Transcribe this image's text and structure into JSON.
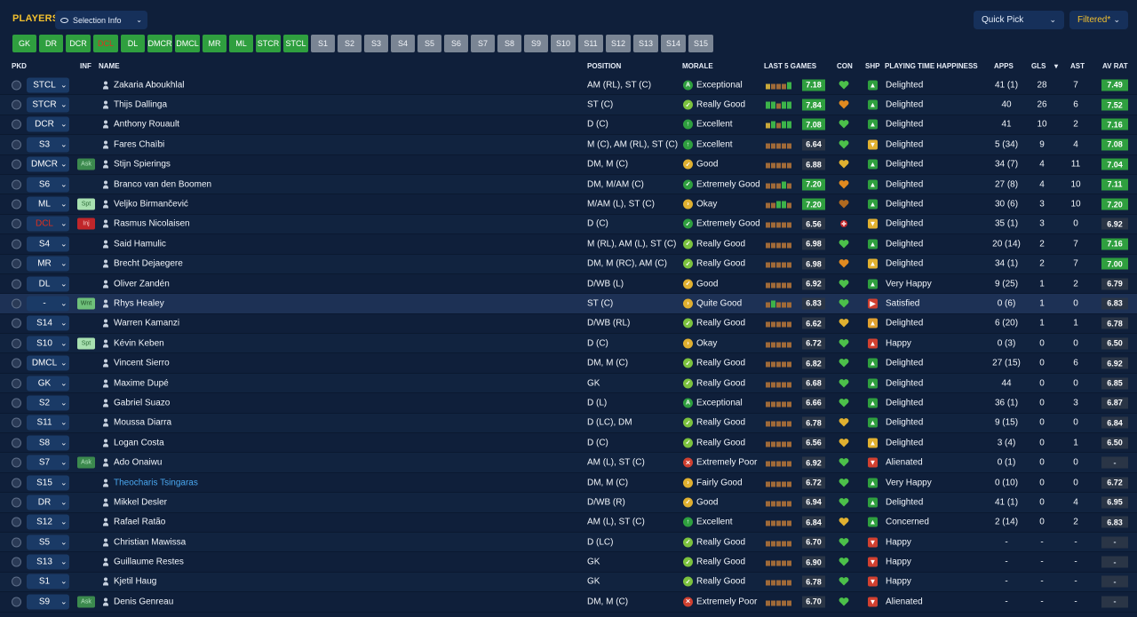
{
  "header": {
    "title": "PLAYERS",
    "selection_info": "Selection Info",
    "quick_pick": "Quick Pick",
    "filtered": "Filtered*"
  },
  "positions": [
    {
      "label": "GK",
      "state": "on"
    },
    {
      "label": "DR",
      "state": "on"
    },
    {
      "label": "DCR",
      "state": "on"
    },
    {
      "label": "DCL",
      "state": "onred"
    },
    {
      "label": "DL",
      "state": "on"
    },
    {
      "label": "DMCR",
      "state": "on"
    },
    {
      "label": "DMCL",
      "state": "on"
    },
    {
      "label": "MR",
      "state": "on"
    },
    {
      "label": "ML",
      "state": "on"
    },
    {
      "label": "STCR",
      "state": "on"
    },
    {
      "label": "STCL",
      "state": "on"
    },
    {
      "label": "S1",
      "state": "off"
    },
    {
      "label": "S2",
      "state": "off"
    },
    {
      "label": "S3",
      "state": "off"
    },
    {
      "label": "S4",
      "state": "off"
    },
    {
      "label": "S5",
      "state": "off"
    },
    {
      "label": "S6",
      "state": "off"
    },
    {
      "label": "S7",
      "state": "off"
    },
    {
      "label": "S8",
      "state": "off"
    },
    {
      "label": "S9",
      "state": "off"
    },
    {
      "label": "S10",
      "state": "off"
    },
    {
      "label": "S11",
      "state": "off"
    },
    {
      "label": "S12",
      "state": "off"
    },
    {
      "label": "S13",
      "state": "off"
    },
    {
      "label": "S14",
      "state": "off"
    },
    {
      "label": "S15",
      "state": "off"
    }
  ],
  "columns": {
    "pkd": "PKD",
    "inf": "INF",
    "name": "NAME",
    "position": "POSITION",
    "morale": "MORALE",
    "last5": "LAST 5 GAMES",
    "con": "CON",
    "shp": "SHP",
    "happiness": "PLAYING TIME HAPPINESS",
    "apps": "APPS",
    "gls": "GLS",
    "sort_arrow": "▾",
    "ast": "AST",
    "avrat": "AV RAT"
  },
  "colors": {
    "green": "#2f9f3f",
    "red": "#e0301e",
    "gold": "#f2c02f",
    "link": "#4aa8f0"
  },
  "players": [
    {
      "sel": "STCL",
      "inf": "",
      "name": "Zakaria Aboukhlal",
      "position": "AM (RL), ST (C)",
      "morale": "Exceptional",
      "micon": "A",
      "mcolor": "#2f9f3f",
      "form": [
        "y",
        "b",
        "b",
        "b",
        "g"
      ],
      "last5": "7.18",
      "l5g": true,
      "con": "green",
      "shp": "up",
      "scolor": "#2f9f3f",
      "happy": "Delighted",
      "apps": "41 (1)",
      "gls": "28",
      "ast": "7",
      "avr": "7.49",
      "avrg": true
    },
    {
      "sel": "STCR",
      "inf": "",
      "name": "Thijs Dallinga",
      "position": "ST (C)",
      "morale": "Really Good",
      "micon": "✓",
      "mcolor": "#7cc23e",
      "form": [
        "g",
        "g",
        "b",
        "g",
        "g"
      ],
      "last5": "7.84",
      "l5g": true,
      "con": "orange",
      "shp": "up",
      "scolor": "#2f9f3f",
      "happy": "Delighted",
      "apps": "40",
      "gls": "26",
      "ast": "6",
      "avr": "7.52",
      "avrg": true
    },
    {
      "sel": "DCR",
      "inf": "",
      "name": "Anthony Rouault",
      "position": "D (C)",
      "morale": "Excellent",
      "micon": "↑",
      "mcolor": "#2f9f3f",
      "form": [
        "y",
        "g",
        "b",
        "g",
        "g"
      ],
      "last5": "7.08",
      "l5g": true,
      "con": "green",
      "shp": "up",
      "scolor": "#2f9f3f",
      "happy": "Delighted",
      "apps": "41",
      "gls": "10",
      "ast": "2",
      "avr": "7.16",
      "avrg": true
    },
    {
      "sel": "S3",
      "inf": "",
      "name": "Fares Chaïbi",
      "position": "M (C), AM (RL), ST (C)",
      "morale": "Excellent",
      "micon": "↑",
      "mcolor": "#2f9f3f",
      "form": [
        "b",
        "b",
        "b",
        "b",
        "b"
      ],
      "last5": "6.64",
      "l5g": false,
      "con": "green",
      "shp": "down",
      "scolor": "#e0b030",
      "happy": "Delighted",
      "apps": "5 (34)",
      "gls": "9",
      "ast": "4",
      "avr": "7.08",
      "avrg": true
    },
    {
      "sel": "DMCR",
      "inf": "Ask",
      "name": "Stijn Spierings",
      "position": "DM, M (C)",
      "morale": "Good",
      "micon": "✓",
      "mcolor": "#e0b030",
      "form": [
        "b",
        "b",
        "b",
        "b",
        "b"
      ],
      "last5": "6.88",
      "l5g": false,
      "con": "gold",
      "shp": "up",
      "scolor": "#2f9f3f",
      "happy": "Delighted",
      "apps": "34 (7)",
      "gls": "4",
      "ast": "11",
      "avr": "7.04",
      "avrg": true
    },
    {
      "sel": "S6",
      "inf": "",
      "name": "Branco van den Boomen",
      "position": "DM, M/AM (C)",
      "morale": "Extremely Good",
      "micon": "✓",
      "mcolor": "#2f9f3f",
      "form": [
        "b",
        "b",
        "b",
        "g",
        "b"
      ],
      "last5": "7.20",
      "l5g": true,
      "con": "orange",
      "shp": "up",
      "scolor": "#2f9f3f",
      "happy": "Delighted",
      "apps": "27 (8)",
      "gls": "4",
      "ast": "10",
      "avr": "7.11",
      "avrg": true
    },
    {
      "sel": "ML",
      "inf": "Spt",
      "name": "Veljko Birmančević",
      "position": "M/AM (L), ST (C)",
      "morale": "Okay",
      "micon": "›",
      "mcolor": "#e0b030",
      "form": [
        "b",
        "b",
        "g",
        "g",
        "b"
      ],
      "last5": "7.20",
      "l5g": true,
      "con": "darkorange",
      "shp": "up",
      "scolor": "#2f9f3f",
      "happy": "Delighted",
      "apps": "30 (6)",
      "gls": "3",
      "ast": "10",
      "avr": "7.20",
      "avrg": true
    },
    {
      "sel": "DCL",
      "selred": true,
      "inf": "Inj",
      "name": "Rasmus Nicolaisen",
      "position": "D (C)",
      "morale": "Extremely Good",
      "micon": "✓",
      "mcolor": "#2f9f3f",
      "form": [
        "b",
        "b",
        "b",
        "b",
        "b"
      ],
      "last5": "6.56",
      "l5g": false,
      "con": "injury",
      "shp": "down",
      "scolor": "#e0b030",
      "happy": "Delighted",
      "apps": "35 (1)",
      "gls": "3",
      "ast": "0",
      "avr": "6.92",
      "avrg": false
    },
    {
      "sel": "S4",
      "inf": "",
      "name": "Said Hamulic",
      "position": "M (RL), AM (L), ST (C)",
      "morale": "Really Good",
      "micon": "✓",
      "mcolor": "#7cc23e",
      "form": [
        "b",
        "b",
        "b",
        "b",
        "b"
      ],
      "last5": "6.98",
      "l5g": false,
      "con": "green",
      "shp": "up",
      "scolor": "#2f9f3f",
      "happy": "Delighted",
      "apps": "20 (14)",
      "gls": "2",
      "ast": "7",
      "avr": "7.16",
      "avrg": true
    },
    {
      "sel": "MR",
      "inf": "",
      "name": "Brecht Dejaegere",
      "position": "DM, M (RC), AM (C)",
      "morale": "Really Good",
      "micon": "✓",
      "mcolor": "#7cc23e",
      "form": [
        "b",
        "b",
        "b",
        "b",
        "b"
      ],
      "last5": "6.98",
      "l5g": false,
      "con": "orange",
      "shp": "up",
      "scolor": "#e0b030",
      "happy": "Delighted",
      "apps": "34 (1)",
      "gls": "2",
      "ast": "7",
      "avr": "7.00",
      "avrg": true
    },
    {
      "sel": "DL",
      "inf": "",
      "name": "Oliver Zandén",
      "position": "D/WB (L)",
      "morale": "Good",
      "micon": "✓",
      "mcolor": "#e0b030",
      "form": [
        "b",
        "b",
        "b",
        "b",
        "b"
      ],
      "last5": "6.92",
      "l5g": false,
      "con": "green",
      "shp": "up",
      "scolor": "#2f9f3f",
      "happy": "Very Happy",
      "apps": "9 (25)",
      "gls": "1",
      "ast": "2",
      "avr": "6.79",
      "avrg": false
    },
    {
      "sel": "-",
      "inf": "Wnt",
      "name": "Rhys Healey",
      "position": "ST (C)",
      "morale": "Quite Good",
      "micon": "›",
      "mcolor": "#e0b030",
      "form": [
        "b",
        "g",
        "b",
        "b",
        "b"
      ],
      "last5": "6.83",
      "l5g": false,
      "con": "green",
      "shp": "right",
      "scolor": "#d04030",
      "happy": "Satisfied",
      "apps": "0 (6)",
      "gls": "1",
      "ast": "0",
      "avr": "6.83",
      "avrg": false,
      "hl": true
    },
    {
      "sel": "S14",
      "inf": "",
      "name": "Warren Kamanzi",
      "position": "D/WB (RL)",
      "morale": "Really Good",
      "micon": "✓",
      "mcolor": "#7cc23e",
      "form": [
        "b",
        "b",
        "b",
        "b",
        "b"
      ],
      "last5": "6.62",
      "l5g": false,
      "con": "gold",
      "shp": "up",
      "scolor": "#e0a030",
      "happy": "Delighted",
      "apps": "6 (20)",
      "gls": "1",
      "ast": "1",
      "avr": "6.78",
      "avrg": false
    },
    {
      "sel": "S10",
      "inf": "Spt",
      "name": "Kévin Keben",
      "position": "D (C)",
      "morale": "Okay",
      "micon": "›",
      "mcolor": "#e0b030",
      "form": [
        "b",
        "b",
        "b",
        "b",
        "b"
      ],
      "last5": "6.72",
      "l5g": false,
      "con": "green",
      "shp": "up",
      "scolor": "#d04030",
      "happy": "Happy",
      "apps": "0 (3)",
      "gls": "0",
      "ast": "0",
      "avr": "6.50",
      "avrg": false
    },
    {
      "sel": "DMCL",
      "inf": "",
      "name": "Vincent Sierro",
      "position": "DM, M (C)",
      "morale": "Really Good",
      "micon": "✓",
      "mcolor": "#7cc23e",
      "form": [
        "b",
        "b",
        "b",
        "b",
        "b"
      ],
      "last5": "6.82",
      "l5g": false,
      "con": "green",
      "shp": "up",
      "scolor": "#2f9f3f",
      "happy": "Delighted",
      "apps": "27 (15)",
      "gls": "0",
      "ast": "6",
      "avr": "6.92",
      "avrg": false
    },
    {
      "sel": "GK",
      "inf": "",
      "name": "Maxime Dupé",
      "position": "GK",
      "morale": "Really Good",
      "micon": "✓",
      "mcolor": "#7cc23e",
      "form": [
        "b",
        "b",
        "b",
        "b",
        "b"
      ],
      "last5": "6.68",
      "l5g": false,
      "con": "green",
      "shp": "up",
      "scolor": "#2f9f3f",
      "happy": "Delighted",
      "apps": "44",
      "gls": "0",
      "ast": "0",
      "avr": "6.85",
      "avrg": false
    },
    {
      "sel": "S2",
      "inf": "",
      "name": "Gabriel Suazo",
      "position": "D (L)",
      "morale": "Exceptional",
      "micon": "A",
      "mcolor": "#2f9f3f",
      "form": [
        "b",
        "b",
        "b",
        "b",
        "b"
      ],
      "last5": "6.66",
      "l5g": false,
      "con": "green",
      "shp": "up",
      "scolor": "#2f9f3f",
      "happy": "Delighted",
      "apps": "36 (1)",
      "gls": "0",
      "ast": "3",
      "avr": "6.87",
      "avrg": false
    },
    {
      "sel": "S11",
      "inf": "",
      "name": "Moussa Diarra",
      "position": "D (LC), DM",
      "morale": "Really Good",
      "micon": "✓",
      "mcolor": "#7cc23e",
      "form": [
        "b",
        "b",
        "b",
        "b",
        "b"
      ],
      "last5": "6.78",
      "l5g": false,
      "con": "gold",
      "shp": "up",
      "scolor": "#2f9f3f",
      "happy": "Delighted",
      "apps": "9 (15)",
      "gls": "0",
      "ast": "0",
      "avr": "6.84",
      "avrg": false
    },
    {
      "sel": "S8",
      "inf": "",
      "name": "Logan Costa",
      "position": "D (C)",
      "morale": "Really Good",
      "micon": "✓",
      "mcolor": "#7cc23e",
      "form": [
        "b",
        "b",
        "b",
        "b",
        "b"
      ],
      "last5": "6.56",
      "l5g": false,
      "con": "gold",
      "shp": "up",
      "scolor": "#e0b030",
      "happy": "Delighted",
      "apps": "3 (4)",
      "gls": "0",
      "ast": "1",
      "avr": "6.50",
      "avrg": false
    },
    {
      "sel": "S7",
      "inf": "Ask",
      "name": "Ado Onaiwu",
      "position": "AM (L), ST (C)",
      "morale": "Extremely Poor",
      "micon": "✕",
      "mcolor": "#d04030",
      "form": [
        "b",
        "b",
        "b",
        "b",
        "b"
      ],
      "last5": "6.92",
      "l5g": false,
      "con": "green",
      "shp": "down",
      "scolor": "#d04030",
      "happy": "Alienated",
      "apps": "0 (1)",
      "gls": "0",
      "ast": "0",
      "avr": "-",
      "avrg": false,
      "avrdash": true
    },
    {
      "sel": "S15",
      "inf": "",
      "name": "Theocharis Tsingaras",
      "link": true,
      "position": "DM, M (C)",
      "morale": "Fairly Good",
      "micon": "›",
      "mcolor": "#e0b030",
      "form": [
        "b",
        "b",
        "b",
        "b",
        "b"
      ],
      "last5": "6.72",
      "l5g": false,
      "con": "green",
      "shp": "up",
      "scolor": "#2f9f3f",
      "happy": "Very Happy",
      "apps": "0 (10)",
      "gls": "0",
      "ast": "0",
      "avr": "6.72",
      "avrg": false
    },
    {
      "sel": "DR",
      "inf": "",
      "name": "Mikkel Desler",
      "position": "D/WB (R)",
      "morale": "Good",
      "micon": "✓",
      "mcolor": "#e0b030",
      "form": [
        "b",
        "b",
        "b",
        "b",
        "b"
      ],
      "last5": "6.94",
      "l5g": false,
      "con": "green",
      "shp": "up",
      "scolor": "#2f9f3f",
      "happy": "Delighted",
      "apps": "41 (1)",
      "gls": "0",
      "ast": "4",
      "avr": "6.95",
      "avrg": false
    },
    {
      "sel": "S12",
      "inf": "",
      "name": "Rafael Ratão",
      "position": "AM (L), ST (C)",
      "morale": "Excellent",
      "micon": "↑",
      "mcolor": "#2f9f3f",
      "form": [
        "b",
        "b",
        "b",
        "b",
        "b"
      ],
      "last5": "6.84",
      "l5g": false,
      "con": "gold",
      "shp": "up",
      "scolor": "#2f9f3f",
      "happy": "Concerned",
      "apps": "2 (14)",
      "gls": "0",
      "ast": "2",
      "avr": "6.83",
      "avrg": false
    },
    {
      "sel": "S5",
      "inf": "",
      "name": "Christian Mawissa",
      "position": "D (LC)",
      "morale": "Really Good",
      "micon": "✓",
      "mcolor": "#7cc23e",
      "form": [
        "b",
        "b",
        "b",
        "b",
        "b"
      ],
      "last5": "6.70",
      "l5g": false,
      "con": "green",
      "shp": "down",
      "scolor": "#d04030",
      "happy": "Happy",
      "apps": "-",
      "gls": "-",
      "ast": "-",
      "avr": "-",
      "avrg": false,
      "avrdash": true
    },
    {
      "sel": "S13",
      "inf": "",
      "name": "Guillaume Restes",
      "position": "GK",
      "morale": "Really Good",
      "micon": "✓",
      "mcolor": "#7cc23e",
      "form": [
        "b",
        "b",
        "b",
        "b",
        "b"
      ],
      "last5": "6.90",
      "l5g": false,
      "con": "green",
      "shp": "down",
      "scolor": "#d04030",
      "happy": "Happy",
      "apps": "-",
      "gls": "-",
      "ast": "-",
      "avr": "-",
      "avrg": false,
      "avrdash": true
    },
    {
      "sel": "S1",
      "inf": "",
      "name": "Kjetil Haug",
      "position": "GK",
      "morale": "Really Good",
      "micon": "✓",
      "mcolor": "#7cc23e",
      "form": [
        "b",
        "b",
        "b",
        "b",
        "b"
      ],
      "last5": "6.78",
      "l5g": false,
      "con": "green",
      "shp": "down",
      "scolor": "#d04030",
      "happy": "Happy",
      "apps": "-",
      "gls": "-",
      "ast": "-",
      "avr": "-",
      "avrg": false,
      "avrdash": true
    },
    {
      "sel": "S9",
      "inf": "Ask",
      "name": "Denis Genreau",
      "position": "DM, M (C)",
      "morale": "Extremely Poor",
      "micon": "✕",
      "mcolor": "#d04030",
      "form": [
        "b",
        "b",
        "b",
        "b",
        "b"
      ],
      "last5": "6.70",
      "l5g": false,
      "con": "green",
      "shp": "down",
      "scolor": "#d04030",
      "happy": "Alienated",
      "apps": "-",
      "gls": "-",
      "ast": "-",
      "avr": "-",
      "avrg": false,
      "avrdash": true
    }
  ]
}
